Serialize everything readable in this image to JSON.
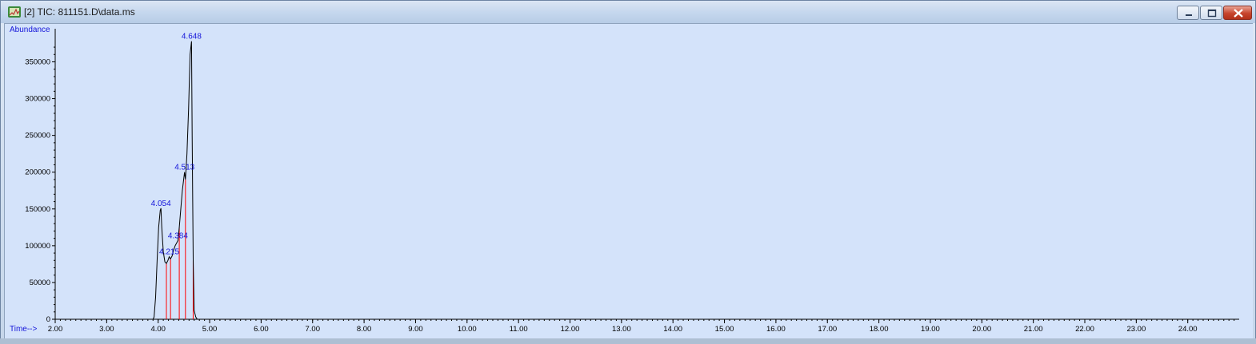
{
  "window": {
    "title": "[2] TIC: 811151.D\\data.ms",
    "icon": "chromatogram-app-icon",
    "controls": [
      "minimize-icon",
      "maximize-icon",
      "close-icon"
    ],
    "colors": {
      "plot_bg": "#d4e3fa",
      "trace": "#000000",
      "integration": "#ff0000",
      "labels": "#1515d9"
    }
  },
  "chart_data": {
    "type": "line",
    "ylabel": "Abundance",
    "xlabel": "Time-->",
    "xlim": [
      2.0,
      25.0
    ],
    "ylim": [
      0,
      380000
    ],
    "x_ticks": [
      "2.00",
      "3.00",
      "4.00",
      "5.00",
      "6.00",
      "7.00",
      "8.00",
      "9.00",
      "10.00",
      "11.00",
      "12.00",
      "13.00",
      "14.00",
      "15.00",
      "16.00",
      "17.00",
      "18.00",
      "19.00",
      "20.00",
      "21.00",
      "22.00",
      "23.00",
      "24.00"
    ],
    "y_ticks": [
      "0",
      "50000",
      "100000",
      "150000",
      "200000",
      "250000",
      "300000",
      "350000"
    ],
    "series": [
      {
        "x": [
          2.0,
          3.0,
          3.9,
          3.92,
          3.95,
          3.98,
          4.01,
          4.04,
          4.054,
          4.07,
          4.1,
          4.13,
          4.16,
          4.19,
          4.215,
          4.24,
          4.27,
          4.3,
          4.33,
          4.36,
          4.384,
          4.41,
          4.44,
          4.47,
          4.5,
          4.513,
          4.53,
          4.56,
          4.59,
          4.62,
          4.648,
          4.66,
          4.68,
          4.7,
          4.73,
          4.76,
          4.8,
          5.0,
          10.0,
          20.0,
          25.0
        ],
        "y": [
          0,
          0,
          0,
          3000,
          30000,
          80000,
          125000,
          148000,
          151000,
          125000,
          92000,
          78000,
          76000,
          80000,
          85000,
          82000,
          86000,
          94000,
          100000,
          104000,
          107000,
          125000,
          150000,
          175000,
          193000,
          200000,
          190000,
          225000,
          285000,
          360000,
          378000,
          250000,
          80000,
          12000,
          3000,
          0,
          0,
          0,
          0,
          0,
          0
        ]
      }
    ],
    "peak_labels": [
      {
        "x": 4.054,
        "y": 151000,
        "text": "4.054"
      },
      {
        "x": 4.215,
        "y": 85000,
        "text": "4.215"
      },
      {
        "x": 4.384,
        "y": 107000,
        "text": "4.384"
      },
      {
        "x": 4.513,
        "y": 200000,
        "text": "4.513"
      },
      {
        "x": 4.648,
        "y": 378000,
        "text": "4.648"
      }
    ],
    "integration_lines": [
      {
        "x": 4.16,
        "y": 76000
      },
      {
        "x": 4.24,
        "y": 82000
      },
      {
        "x": 4.41,
        "y": 125000
      },
      {
        "x": 4.53,
        "y": 190000
      },
      {
        "x": 4.68,
        "y": 80000
      }
    ],
    "grid": false
  }
}
